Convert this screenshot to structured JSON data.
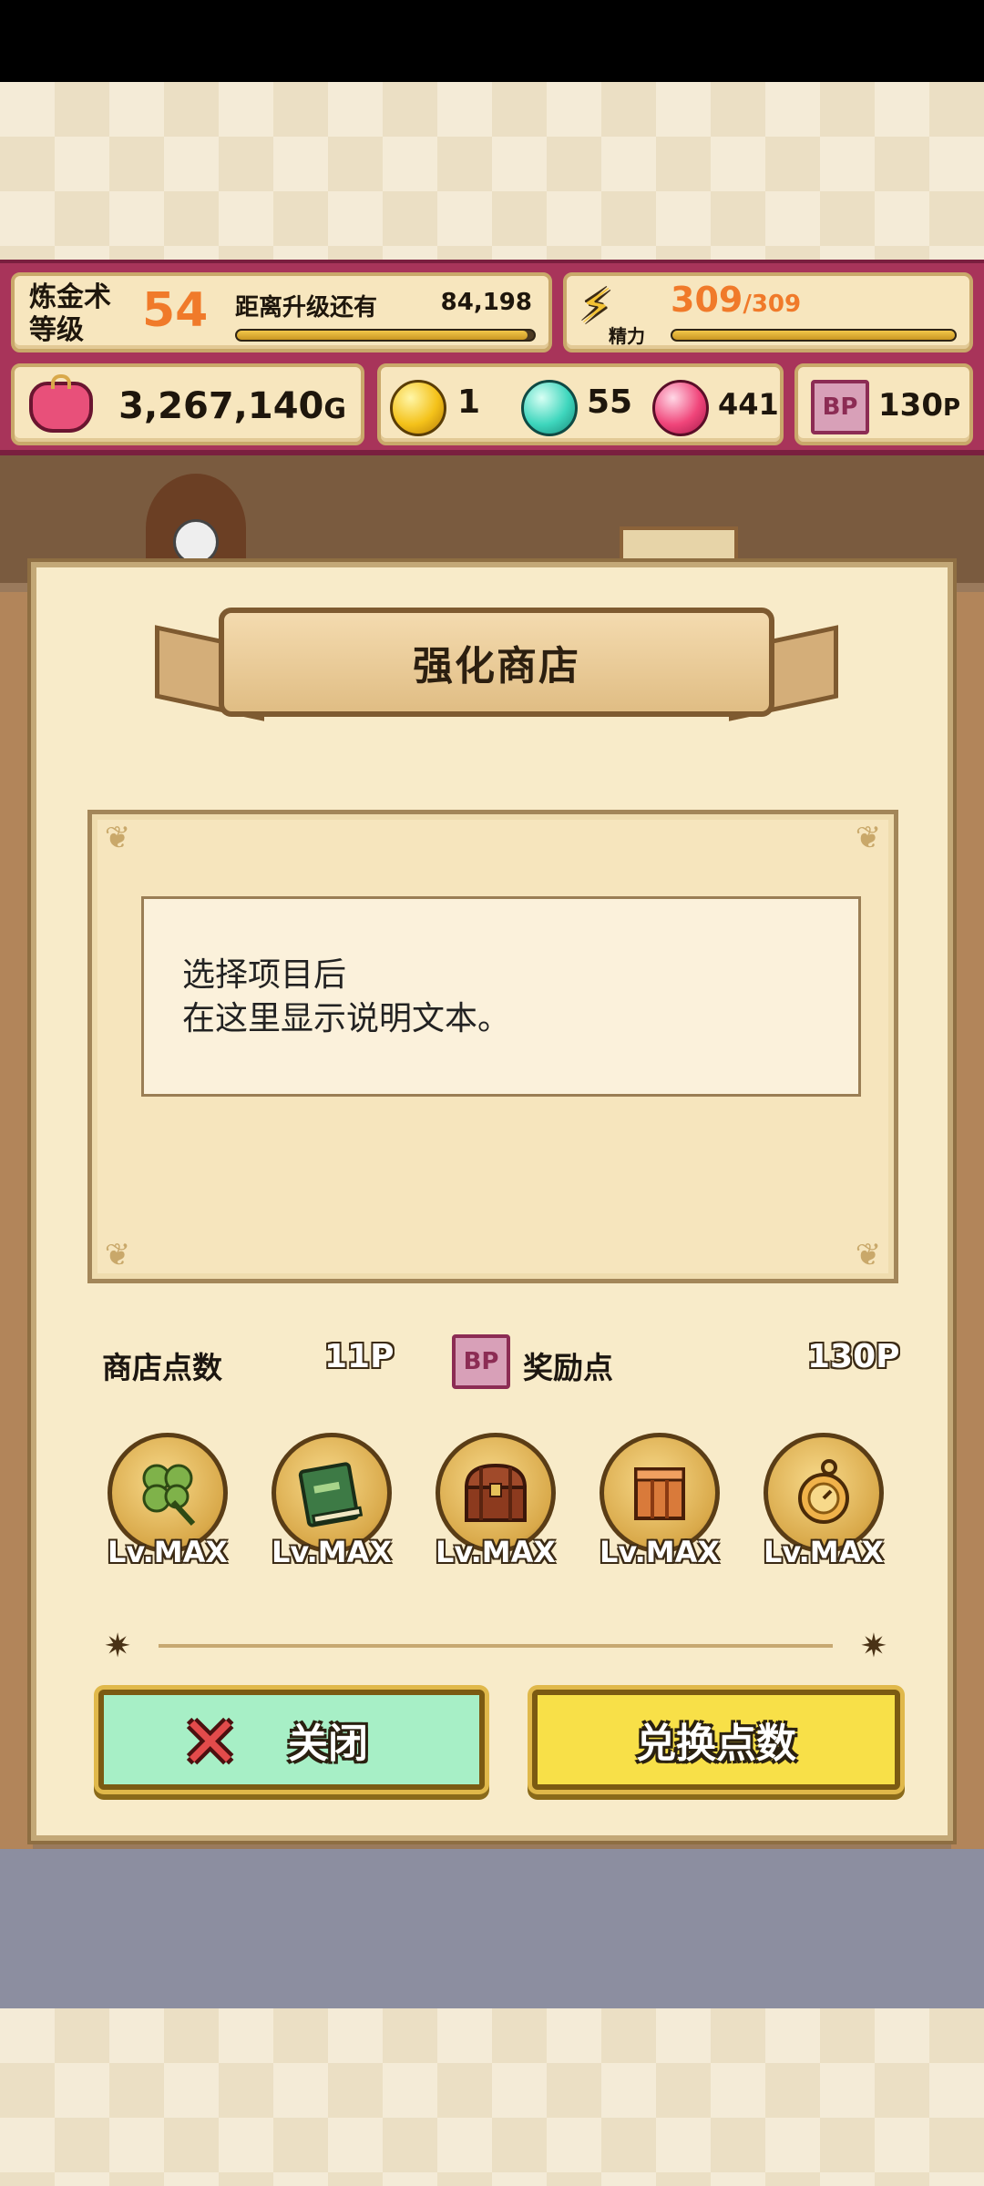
{
  "hud": {
    "alchemy_label_line1": "炼金术",
    "alchemy_label_line2": "等级",
    "level": "54",
    "next_level_label": "距离升级还有",
    "next_level_value": "84,198",
    "exp_progress": 0.98,
    "energy_label": "精力",
    "energy_current": "309",
    "energy_max": "/309",
    "energy_progress": 1.0,
    "gold": "3,267,140",
    "gold_unit": "G",
    "gem_yellow": "1",
    "gem_teal": "55",
    "gem_pink": "441",
    "bp_points": "130",
    "bp_unit": "P",
    "bp_icon_text": "BP"
  },
  "modal": {
    "title": "强化商店",
    "description_line1": "选择项目后",
    "description_line2": "在这里显示说明文本。",
    "shop_points_label": "商店点数",
    "shop_points_value": "11P",
    "reward_label": "奖励点",
    "reward_value": "130P",
    "bp_icon_text": "BP",
    "upgrades": [
      {
        "icon": "clover-icon",
        "level": "Lv.MAX"
      },
      {
        "icon": "book-icon",
        "level": "Lv.MAX"
      },
      {
        "icon": "treasure-chest-icon",
        "level": "Lv.MAX"
      },
      {
        "icon": "crate-icon",
        "level": "Lv.MAX"
      },
      {
        "icon": "stopwatch-icon",
        "level": "Lv.MAX"
      }
    ],
    "close_label": "关闭",
    "exchange_label": "兑换点数"
  },
  "colors": {
    "hud_bg": "#a8345a",
    "accent_orange": "#f07a2a",
    "close_button": "#a7efc6",
    "exchange_button": "#f8e048"
  }
}
